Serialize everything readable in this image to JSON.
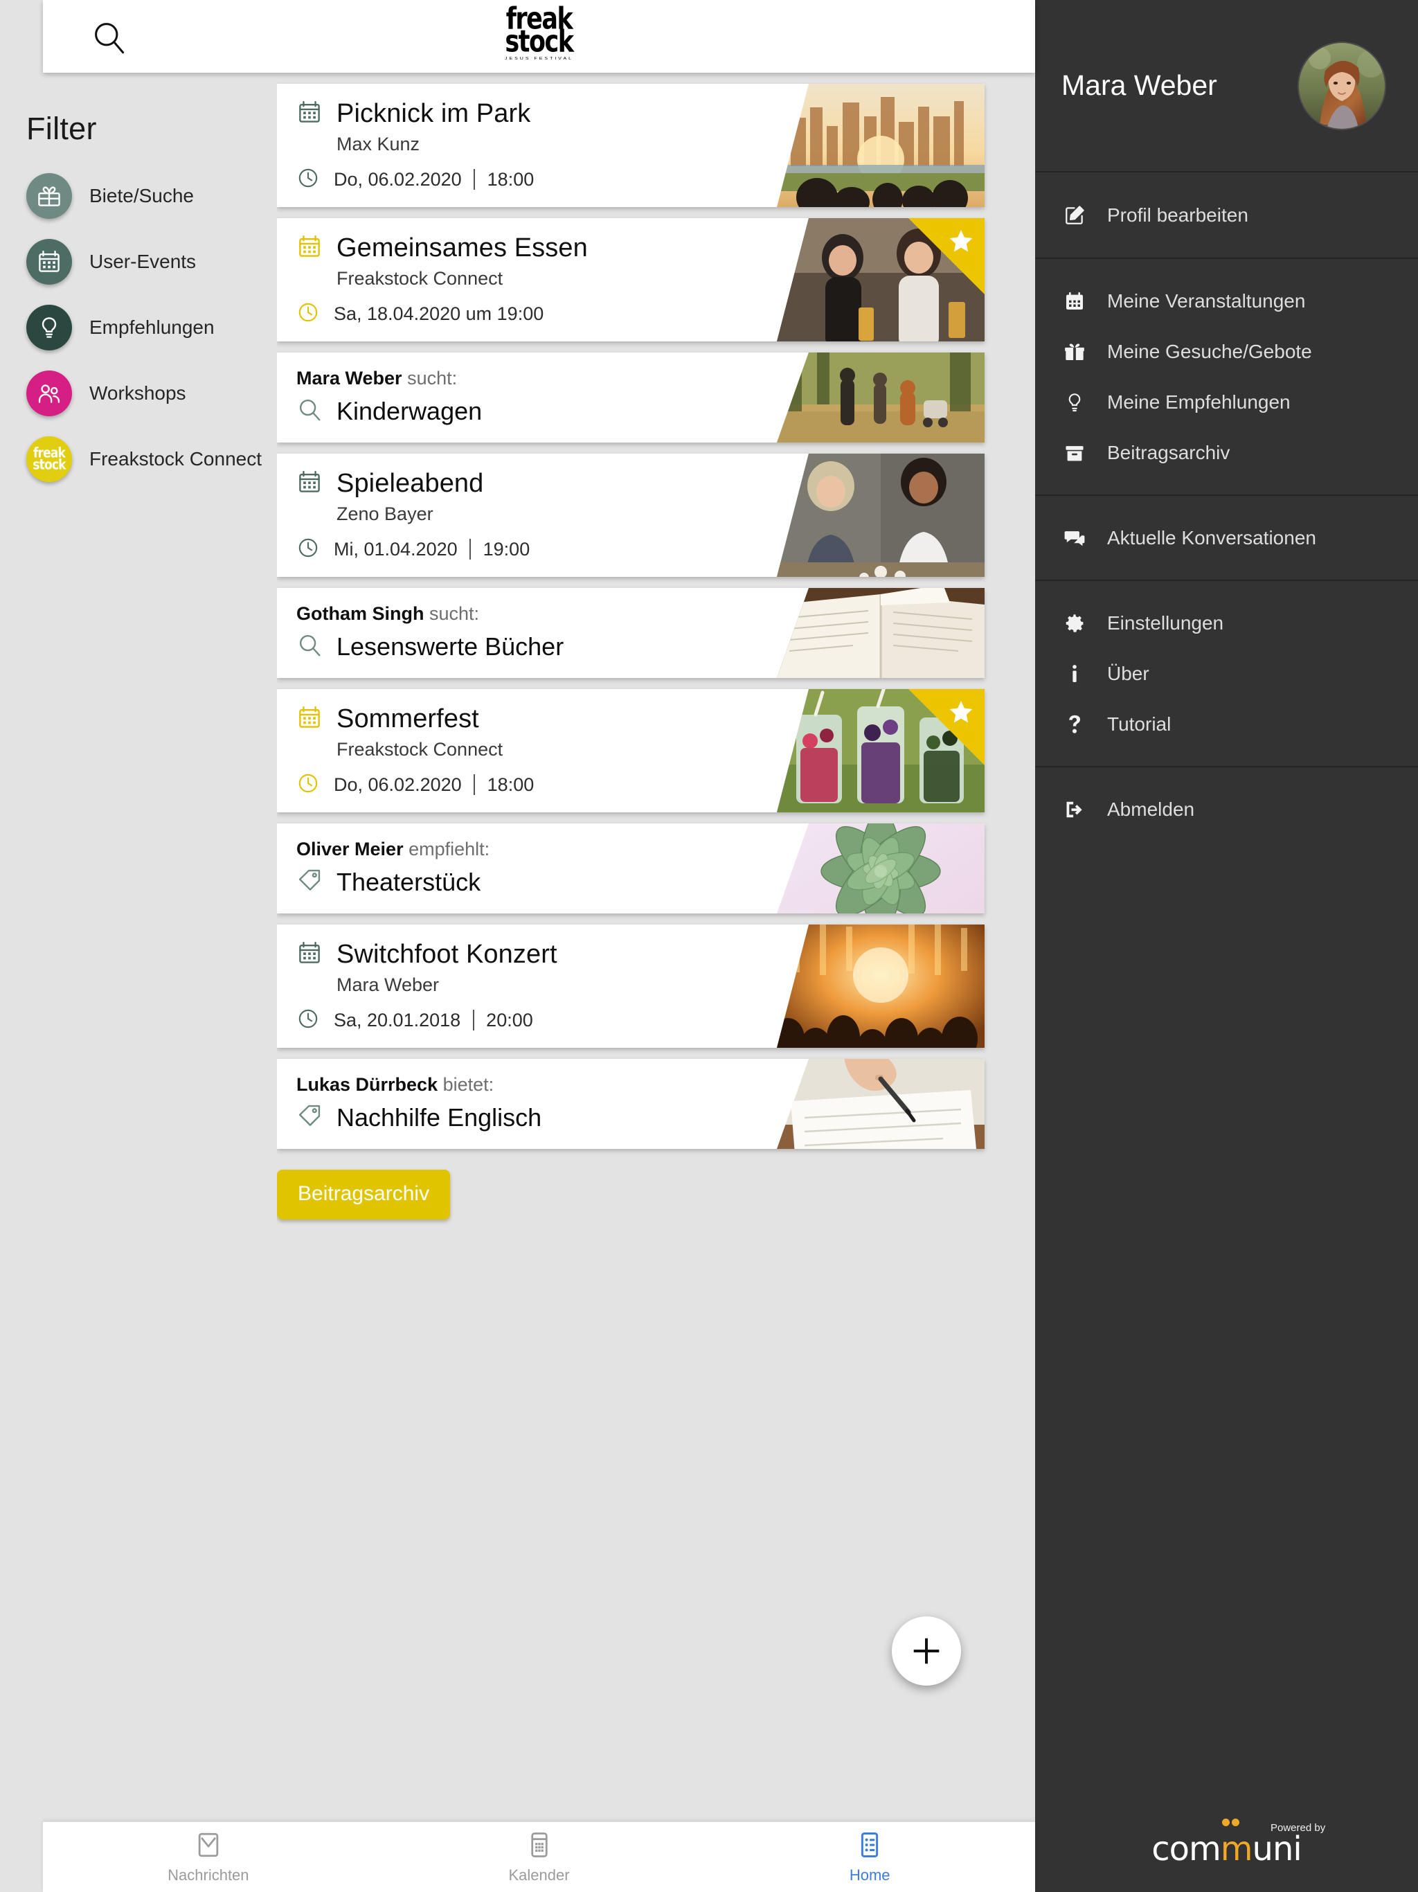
{
  "topbar": {
    "search_icon": "search-icon",
    "logo_line1": "freak",
    "logo_line2": "stock",
    "logo_sub": "JESUS FESTIVAL"
  },
  "filter": {
    "title": "Filter",
    "items": [
      {
        "label": "Biete/Suche",
        "icon": "gift-icon",
        "color": "#6f8a83"
      },
      {
        "label": "User-Events",
        "icon": "calendar-icon",
        "color": "#4d6d64"
      },
      {
        "label": "Empfehlungen",
        "icon": "bulb-icon",
        "color": "#2b4840"
      },
      {
        "label": "Workshops",
        "icon": "people-icon",
        "color": "#d61f84"
      },
      {
        "label": "Freakstock Connect",
        "icon": "freakstock-logo-icon",
        "color": "#e2ce10"
      }
    ]
  },
  "feed": {
    "cards": [
      {
        "kind": "event",
        "accent": "#4e6b62",
        "featured": false,
        "title": "Picknick im Park",
        "owner": "Max Kunz",
        "date": "Do, 06.02.2020",
        "time": "18:00",
        "thumb": "picnic-sunset-skyline-photo"
      },
      {
        "kind": "event",
        "accent": "#e2c200",
        "featured": true,
        "title": "Gemeinsames Essen",
        "owner": "Freakstock Connect",
        "date": "Sa, 18.04.2020 um 19:00",
        "time": "",
        "thumb": "two-women-drinks-photo"
      },
      {
        "kind": "post",
        "accent": "#6f8a83",
        "post_icon": "search-icon",
        "author": "Mara Weber",
        "verb": "sucht:",
        "title": "Kinderwagen",
        "thumb": "family-walking-autumn-photo"
      },
      {
        "kind": "event",
        "accent": "#4e6b62",
        "featured": false,
        "title": "Spieleabend",
        "owner": "Zeno Bayer",
        "date": "Mi, 01.04.2020",
        "time": "19:00",
        "thumb": "two-women-board-game-photo"
      },
      {
        "kind": "post",
        "accent": "#6f8a83",
        "post_icon": "search-icon",
        "author": "Gotham Singh",
        "verb": "sucht:",
        "title": "Lesenswerte Bücher",
        "thumb": "open-book-pages-photo"
      },
      {
        "kind": "event",
        "accent": "#e2c200",
        "featured": true,
        "title": "Sommerfest",
        "owner": "Freakstock Connect",
        "date": "Do, 06.02.2020",
        "time": "18:00",
        "thumb": "berry-drinks-photo"
      },
      {
        "kind": "post",
        "accent": "#6f8a83",
        "post_icon": "tag-icon",
        "author": "Oliver Meier",
        "verb": "empfiehlt:",
        "title": "Theaterstück",
        "thumb": "succulent-plant-pink-photo"
      },
      {
        "kind": "event",
        "accent": "#4e6b62",
        "featured": false,
        "title": "Switchfoot Konzert",
        "owner": "Mara Weber",
        "date": "Sa, 20.01.2018",
        "time": "20:00",
        "thumb": "concert-crowd-stage-photo"
      },
      {
        "kind": "post",
        "accent": "#6f8a83",
        "post_icon": "tag-icon",
        "author": "Lukas Dürrbeck",
        "verb": "bietet:",
        "title": "Nachhilfe Englisch",
        "thumb": "hand-writing-notebook-photo"
      }
    ],
    "archive_button": "Beitragsarchiv",
    "fab_icon": "plus-icon"
  },
  "bottom_nav": {
    "items": [
      {
        "label": "Nachrichten",
        "icon": "envelope-icon",
        "active": false
      },
      {
        "label": "Kalender",
        "icon": "calendar-icon",
        "active": false
      },
      {
        "label": "Home",
        "icon": "list-icon",
        "active": true
      }
    ],
    "active_color": "#3b7ddd",
    "inactive_color": "#9b9b9b"
  },
  "sidebar": {
    "user_name": "Mara Weber",
    "avatar": "user-avatar-photo",
    "group1": [
      {
        "label": "Profil bearbeiten",
        "icon": "edit-square-icon"
      }
    ],
    "group2": [
      {
        "label": "Meine Veranstaltungen",
        "icon": "calendar-icon"
      },
      {
        "label": "Meine Gesuche/Gebote",
        "icon": "gift-icon"
      },
      {
        "label": "Meine Empfehlungen",
        "icon": "bulb-icon"
      },
      {
        "label": "Beitragsarchiv",
        "icon": "archive-box-icon"
      }
    ],
    "group3": [
      {
        "label": "Aktuelle Konversationen",
        "icon": "chat-bubbles-icon"
      }
    ],
    "group4": [
      {
        "label": "Einstellungen",
        "icon": "gear-icon"
      },
      {
        "label": "Über",
        "icon": "info-icon"
      },
      {
        "label": "Tutorial",
        "icon": "question-mark-icon"
      }
    ],
    "group5": [
      {
        "label": "Abmelden",
        "icon": "logout-icon"
      }
    ],
    "footer": {
      "powered_by": "Powered by",
      "brand_pre": "com",
      "brand_m": "m",
      "brand_post": "uni"
    }
  }
}
